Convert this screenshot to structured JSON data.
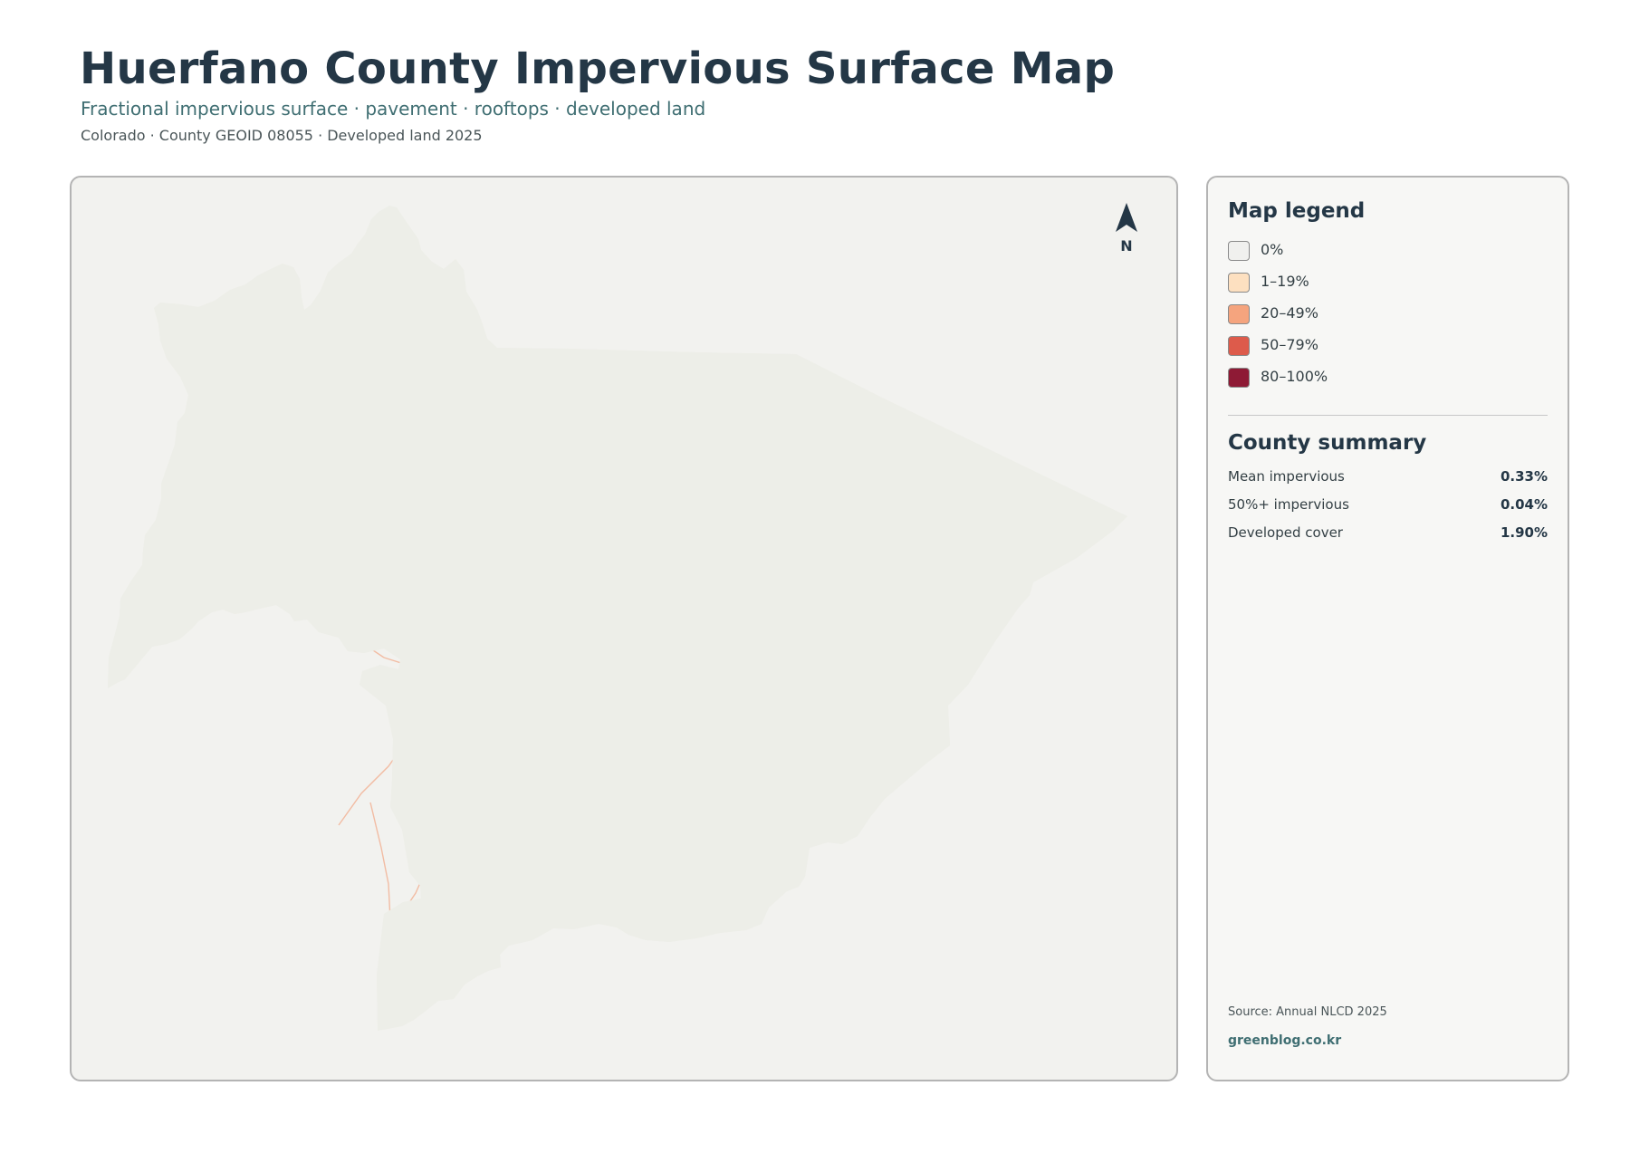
{
  "header": {
    "title": "Huerfano County Impervious Surface Map",
    "subtitle": "Fractional impervious surface · pavement · rooftops · developed land",
    "meta": "Colorado · County GEOID 08055 · Developed land 2025"
  },
  "map": {
    "north_label": "N",
    "colors": {
      "county_fill": "#edeee8",
      "boundary": "#1f2f36",
      "roads": "#f2a98a",
      "town_core": "#d9553f"
    }
  },
  "legend": {
    "title": "Map legend",
    "items": [
      {
        "label": "0%",
        "color": "#f0f0ee"
      },
      {
        "label": "1–19%",
        "color": "#fde0c0"
      },
      {
        "label": "20–49%",
        "color": "#f5a47e"
      },
      {
        "label": "50–79%",
        "color": "#dd5b4b"
      },
      {
        "label": "80–100%",
        "color": "#8e1a35"
      }
    ]
  },
  "summary": {
    "title": "County summary",
    "rows": [
      {
        "label": "Mean impervious",
        "value": "0.33%"
      },
      {
        "label": "50%+ impervious",
        "value": "0.04%"
      },
      {
        "label": "Developed cover",
        "value": "1.90%"
      }
    ]
  },
  "footer": {
    "source": "Source: Annual NLCD 2025",
    "credit": "greenblog.co.kr"
  }
}
